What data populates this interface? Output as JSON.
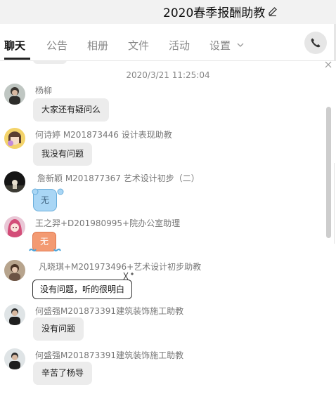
{
  "window": {
    "title": "2020春季报酬助教"
  },
  "tabs": [
    {
      "label": "聊天"
    },
    {
      "label": "公告"
    },
    {
      "label": "相册"
    },
    {
      "label": "文件"
    },
    {
      "label": "活动"
    },
    {
      "label": "设置"
    }
  ],
  "chat": {
    "timestamp": "2020/3/21 11:25:04",
    "messages": [
      {
        "sender": "杨柳",
        "text": "大家还有疑问么"
      },
      {
        "sender": "何诗婷 M201873446 设计表现助教",
        "text": "我没有问题"
      },
      {
        "sender": "詹新颖 M201877367 艺术设计初步（二）",
        "text": "无"
      },
      {
        "sender": "王之羿+D201980995+院办公室助理",
        "text": "无"
      },
      {
        "sender": "凡晓琪+M201973496+艺术设计初步助教",
        "text": "没有问题，听的很明白"
      },
      {
        "sender": "何盛强M201873391建筑装饰施工助教",
        "text": "没有问题"
      },
      {
        "sender": "何盛强M201873391建筑装饰施工助教",
        "text": "辛苦了杨导"
      }
    ]
  },
  "icons": {
    "edit": "pencil-icon",
    "settings_dropdown": "chevron-down-icon",
    "call": "phone-icon",
    "close": "close-icon"
  },
  "colors": {
    "titlebar_bg": "#f2f2f2",
    "bubble_gray": "#ececec",
    "bubble_blue": "#a9d6f5",
    "bubble_orange": "#f39a72"
  }
}
